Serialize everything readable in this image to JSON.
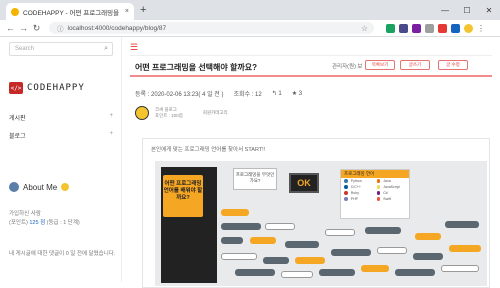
{
  "browser": {
    "tab_title": "CODEHAPPY - 어떤 프로그래밍을 선...",
    "tab_close": "×",
    "new_tab": "+",
    "url": "localhost:4000/codehappy/blog/87",
    "back": "←",
    "forward": "→",
    "reload": "↻",
    "bookmark": "☆",
    "window_controls": [
      "—",
      "☐",
      "✕"
    ]
  },
  "sidebar": {
    "search_placeholder": "Search",
    "search_icon": "⌕",
    "logo_mark": "</>",
    "logo_text": "CODEHAPPY",
    "items": [
      {
        "label": "게시판",
        "toggle": "+"
      },
      {
        "label": "블로그",
        "toggle": "+"
      }
    ],
    "about_title": "About Me",
    "stats": [
      {
        "prefix": "가입하신 사람 ",
        "value": "",
        "suffix": ""
      },
      {
        "prefix": "(포인트)",
        "value": "125 점",
        "suffix": " (등급 : 1 단계)"
      },
      {
        "prefix": "내 게시글에 대한 댓글이 0 일 전에 달렸습니다.",
        "value": "",
        "suffix": ""
      }
    ]
  },
  "main": {
    "menu_icon": "☰",
    "post_title": "어떤 프로그래밍을 선택해야 할까요?",
    "related_label": "관리자(원) 보",
    "buttons": [
      "목록보기",
      "글쓰기",
      "글 수정"
    ],
    "meta": {
      "date": "등록 : 2020-02-06 13:23( 4 일 전 )",
      "views": "조회수 : 12",
      "replies": "↰ 1",
      "stars": "★ 3"
    },
    "author": {
      "name": "코써 블로그",
      "detail": "포인트 : 100점",
      "sub": "회원카테고리"
    },
    "content": {
      "intro": "본인에게 맞는 프로그래밍 언어를 찾아서 START!!",
      "infographic": {
        "headline": "어떤 프로그래밍 언어를 배워야 할까요?",
        "question": "프로그래밍을 무엇인가요?",
        "ok": "OK",
        "panel_title": "프로그래밍 언어",
        "languages": [
          "Python",
          "Java",
          "C/C++",
          "JavaScript",
          "Ruby",
          "C#",
          "PHP",
          "Swift"
        ],
        "lang_colors": [
          "#3776ab",
          "#e76f00",
          "#00599c",
          "#f0db4f",
          "#cc342d",
          "#68217a",
          "#777bb3",
          "#f05138"
        ]
      }
    }
  },
  "colors": {
    "accent": "#e53935",
    "orange": "#f5a623"
  }
}
